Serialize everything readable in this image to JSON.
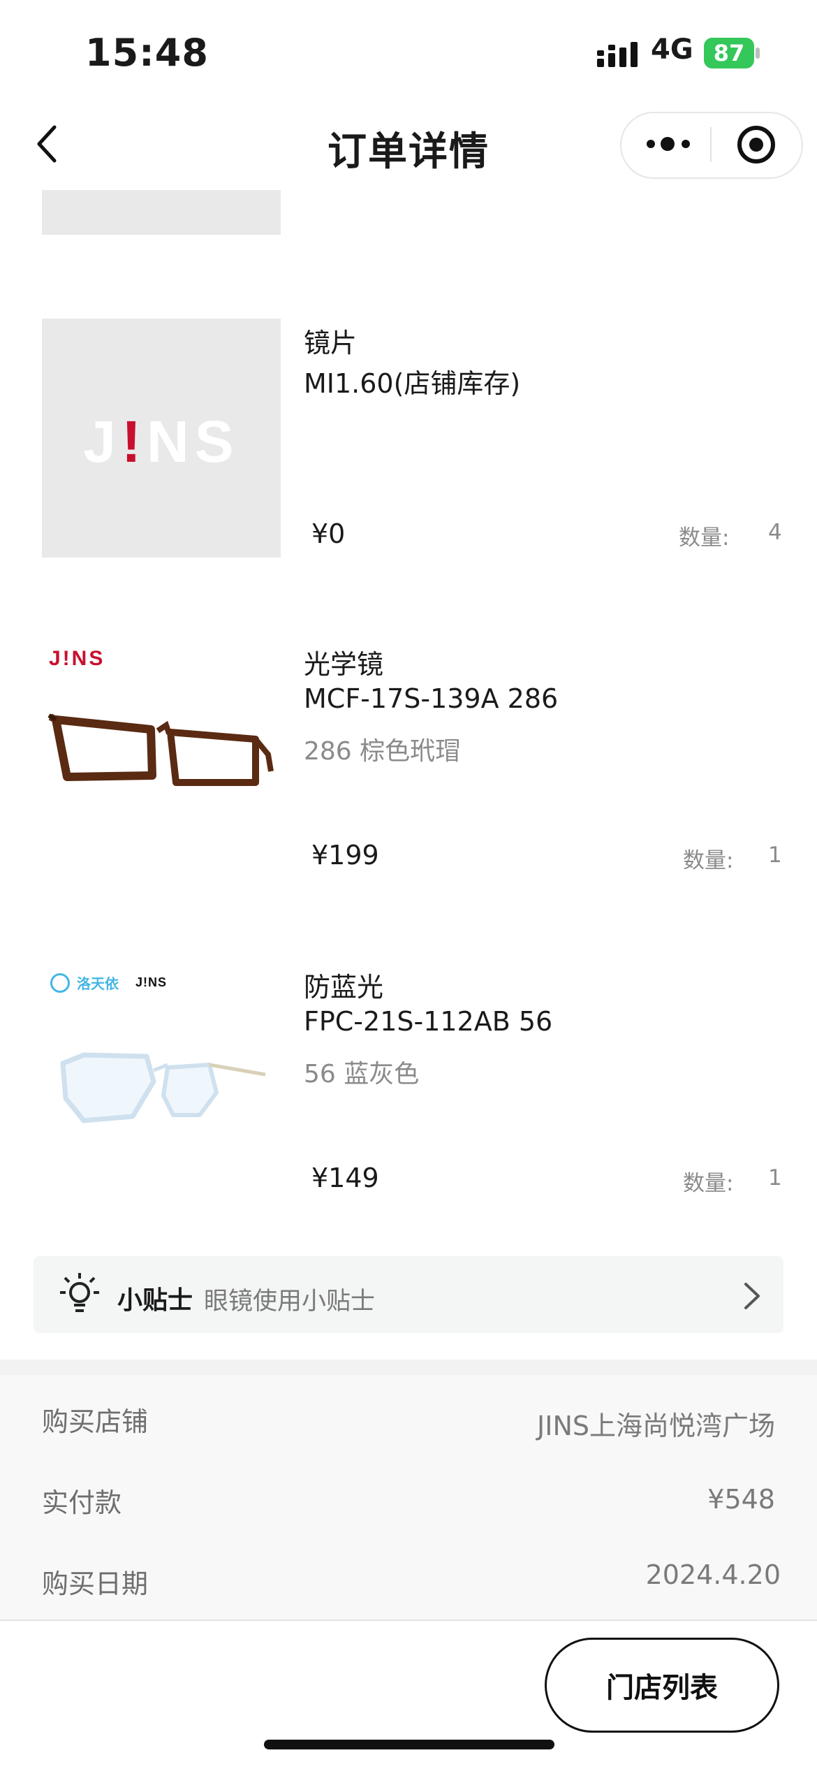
{
  "status_bar": {
    "time": "15:48",
    "network": "4G",
    "battery": "87",
    "battery_color": "#34c759"
  },
  "nav": {
    "title": "订单详情",
    "back_icon": "chevron-left-icon",
    "more_icon": "more-dots-icon",
    "target_icon": "target-icon"
  },
  "items": [
    {
      "name": "镜片",
      "sku": "MI1.60(店铺库存)",
      "variant": "",
      "price": "¥0",
      "qty_label": "数量:",
      "qty": "4",
      "thumb_logo": "J!NS"
    },
    {
      "name": "光学镜",
      "sku": "MCF-17S-139A 286",
      "variant": "286 棕色玳瑁",
      "price": "¥199",
      "qty_label": "数量:",
      "qty": "1",
      "thumb_logo": "J!NS"
    },
    {
      "name": "防蓝光",
      "sku": "FPC-21S-112AB 56",
      "variant": "56 蓝灰色",
      "price": "¥149",
      "qty_label": "数量:",
      "qty": "1",
      "thumb_logo": "J!NS",
      "thumb_brand": "洛天依"
    }
  ],
  "tip": {
    "title": "小贴士",
    "text": "眼镜使用小贴士"
  },
  "info": {
    "store_label": "购买店铺",
    "store_value": "JINS上海尚悦湾广场",
    "paid_label": "实付款",
    "paid_value": "¥548",
    "date_label": "购买日期",
    "date_value": "2024.4.20"
  },
  "footer": {
    "store_list_button": "门店列表"
  },
  "colors": {
    "jins_red": "#c8102e",
    "tip_bg": "#f4f5f5"
  }
}
